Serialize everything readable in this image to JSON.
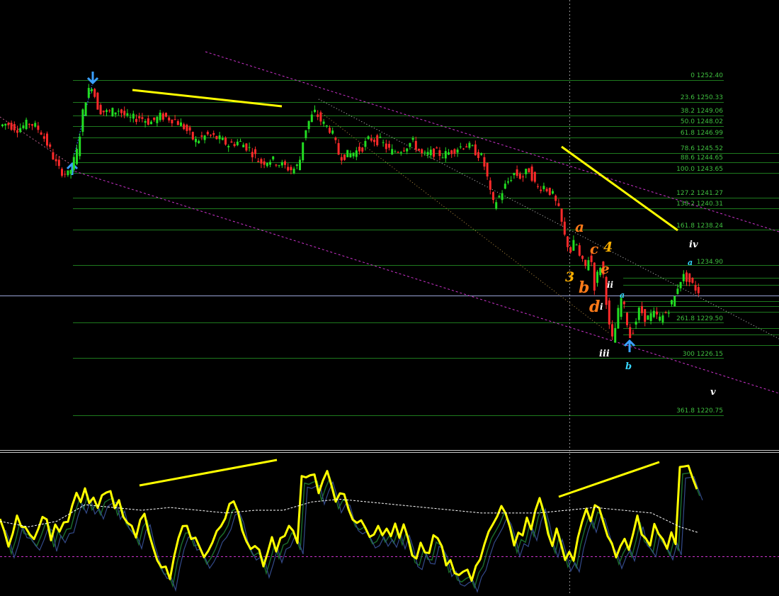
{
  "colors": {
    "background": "#000000",
    "fib_line": "#1e7a1e",
    "fib_label": "#3fbf3f",
    "bull_candle": "#22dd22",
    "bear_candle": "#ff2a2a",
    "channel": "#cc33cc",
    "trendline": "#ffff00",
    "crosshair": "#8f8f8f",
    "price_line": "#9aa4d6",
    "oscillator": "#ffff00",
    "oscillator_signal": "#ffffff",
    "oscillator_shadow": "#1a6a2a",
    "oscillator_level": "#cc33cc",
    "arrow_marker": "#3aa0ff",
    "wave_orange": "#ff7a18",
    "wave_gold": "#ffb000",
    "wave_white": "#ffffff",
    "wave_cyan": "#36d6ff"
  },
  "chart_data": {
    "type": "candlestick",
    "ylim": [
      1218.5,
      1258.0
    ],
    "fib_levels": [
      {
        "ratio": "0",
        "price": 1252.4,
        "text": "0 1252.40"
      },
      {
        "ratio": "23.6",
        "price": 1250.33,
        "text": "23.6 1250.33"
      },
      {
        "ratio": "38.2",
        "price": 1249.06,
        "text": "38.2 1249.06"
      },
      {
        "ratio": "50.0",
        "price": 1248.02,
        "text": "50.0 1248.02"
      },
      {
        "ratio": "61.8",
        "price": 1246.99,
        "text": "61.8 1246.99"
      },
      {
        "ratio": "78.6",
        "price": 1245.52,
        "text": "78.6 1245.52"
      },
      {
        "ratio": "88.6",
        "price": 1244.65,
        "text": "88.6 1244.65"
      },
      {
        "ratio": "100.0",
        "price": 1243.65,
        "text": "100.0 1243.65"
      },
      {
        "ratio": "127.2",
        "price": 1241.27,
        "text": "127.2 1241.27"
      },
      {
        "ratio": "138.2",
        "price": 1240.31,
        "text": "138.2 1240.31"
      },
      {
        "ratio": "161.8",
        "price": 1238.24,
        "text": "161.8 1238.24"
      },
      {
        "ratio": "200.0",
        "price": 1234.9,
        "text": "1234.90"
      },
      {
        "ratio": "261.8",
        "price": 1229.5,
        "text": "261.8 1229.50"
      },
      {
        "ratio": "300",
        "price": 1226.15,
        "text": "300 1226.15"
      },
      {
        "ratio": "361.8",
        "price": 1220.75,
        "text": "361.8 1220.75"
      }
    ],
    "wave_labels": [
      {
        "text": "a",
        "color": "wave_orange"
      },
      {
        "text": "c",
        "color": "wave_orange"
      },
      {
        "text": "4",
        "color": "wave_gold"
      },
      {
        "text": "e",
        "color": "wave_orange"
      },
      {
        "text": "3",
        "color": "wave_gold"
      },
      {
        "text": "b",
        "color": "wave_orange"
      },
      {
        "text": "d",
        "color": "wave_orange"
      },
      {
        "text": "ii",
        "color": "wave_white"
      },
      {
        "text": "i",
        "color": "wave_white"
      },
      {
        "text": "iii",
        "color": "wave_white"
      },
      {
        "text": "iv",
        "color": "wave_white"
      },
      {
        "text": "v",
        "color": "wave_white"
      },
      {
        "text": "a",
        "color": "wave_cyan"
      },
      {
        "text": "b",
        "color": "wave_cyan"
      },
      {
        "text": "a",
        "color": "wave_cyan"
      }
    ],
    "price_path": [
      [
        0,
        1248.0
      ],
      [
        12,
        1248.3
      ],
      [
        28,
        1247.8
      ],
      [
        45,
        1248.4
      ],
      [
        60,
        1247.6
      ],
      [
        72,
        1246.0
      ],
      [
        85,
        1244.0
      ],
      [
        100,
        1243.4
      ],
      [
        112,
        1245.8
      ],
      [
        122,
        1250.4
      ],
      [
        132,
        1252.0
      ],
      [
        142,
        1249.6
      ],
      [
        155,
        1249.3
      ],
      [
        170,
        1249.6
      ],
      [
        185,
        1248.7
      ],
      [
        200,
        1248.9
      ],
      [
        215,
        1248.4
      ],
      [
        230,
        1249.0
      ],
      [
        248,
        1248.7
      ],
      [
        262,
        1248.0
      ],
      [
        278,
        1246.6
      ],
      [
        295,
        1247.2
      ],
      [
        310,
        1246.9
      ],
      [
        325,
        1246.3
      ],
      [
        340,
        1246.6
      ],
      [
        355,
        1245.9
      ],
      [
        370,
        1244.6
      ],
      [
        385,
        1244.9
      ],
      [
        400,
        1244.4
      ],
      [
        415,
        1243.9
      ],
      [
        425,
        1244.4
      ],
      [
        432,
        1247.4
      ],
      [
        440,
        1248.7
      ],
      [
        448,
        1249.4
      ],
      [
        458,
        1248.3
      ],
      [
        470,
        1247.7
      ],
      [
        482,
        1245.2
      ],
      [
        497,
        1245.4
      ],
      [
        512,
        1245.9
      ],
      [
        525,
        1246.9
      ],
      [
        540,
        1246.6
      ],
      [
        555,
        1245.6
      ],
      [
        570,
        1245.9
      ],
      [
        585,
        1246.6
      ],
      [
        600,
        1245.2
      ],
      [
        615,
        1245.6
      ],
      [
        630,
        1245.3
      ],
      [
        645,
        1245.9
      ],
      [
        660,
        1246.3
      ],
      [
        672,
        1245.8
      ],
      [
        684,
        1245.0
      ],
      [
        690,
        1243.4
      ],
      [
        698,
        1240.6
      ],
      [
        706,
        1241.2
      ],
      [
        716,
        1242.4
      ],
      [
        728,
        1243.6
      ],
      [
        740,
        1243.2
      ],
      [
        750,
        1244.0
      ],
      [
        760,
        1242.2
      ],
      [
        770,
        1242.4
      ],
      [
        782,
        1241.7
      ],
      [
        792,
        1240.0
      ],
      [
        800,
        1237.6
      ],
      [
        808,
        1236.2
      ],
      [
        815,
        1237.3
      ],
      [
        822,
        1235.4
      ],
      [
        830,
        1234.7
      ],
      [
        836,
        1236.2
      ],
      [
        842,
        1232.9
      ],
      [
        850,
        1235.0
      ],
      [
        856,
        1233.6
      ],
      [
        862,
        1229.3
      ],
      [
        868,
        1227.6
      ],
      [
        874,
        1230.0
      ],
      [
        880,
        1231.8
      ],
      [
        886,
        1230.3
      ],
      [
        892,
        1228.1
      ],
      [
        898,
        1229.1
      ],
      [
        906,
        1230.8
      ],
      [
        915,
        1229.8
      ],
      [
        925,
        1230.3
      ],
      [
        935,
        1229.8
      ],
      [
        945,
        1230.6
      ],
      [
        955,
        1231.8
      ],
      [
        962,
        1233.5
      ],
      [
        970,
        1233.9
      ],
      [
        978,
        1233.2
      ],
      [
        988,
        1232.5
      ]
    ],
    "oscillator": {
      "level": 0.62,
      "signal_points": [
        [
          0,
          0.52
        ],
        [
          40,
          0.48
        ],
        [
          80,
          0.52
        ],
        [
          120,
          0.64
        ],
        [
          160,
          0.62
        ],
        [
          200,
          0.6
        ],
        [
          240,
          0.62
        ],
        [
          280,
          0.6
        ],
        [
          320,
          0.58
        ],
        [
          360,
          0.6
        ],
        [
          400,
          0.6
        ],
        [
          440,
          0.66
        ],
        [
          480,
          0.68
        ],
        [
          520,
          0.66
        ],
        [
          560,
          0.64
        ],
        [
          600,
          0.62
        ],
        [
          640,
          0.6
        ],
        [
          680,
          0.58
        ],
        [
          720,
          0.58
        ],
        [
          760,
          0.58
        ],
        [
          800,
          0.6
        ],
        [
          840,
          0.62
        ],
        [
          880,
          0.6
        ],
        [
          920,
          0.58
        ],
        [
          960,
          0.48
        ],
        [
          985,
          0.44
        ]
      ]
    }
  }
}
